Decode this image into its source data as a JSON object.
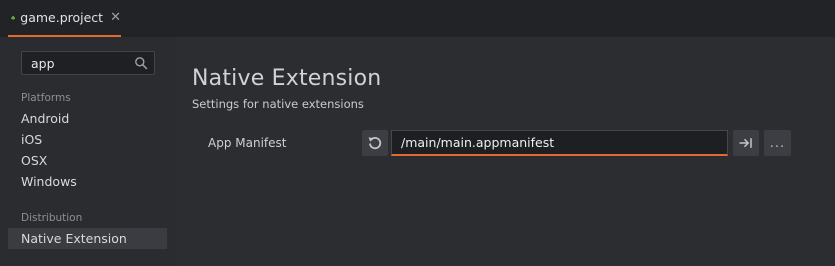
{
  "tabs": [
    {
      "label": "game.project",
      "close_glyph": "✕",
      "icon": "defold-leaf-icon",
      "accent": "#e26a31",
      "icon_color": "#6ac044"
    }
  ],
  "sidebar": {
    "search": {
      "value": "app",
      "placeholder": ""
    },
    "sections": [
      {
        "label": "Platforms",
        "items": [
          "Android",
          "iOS",
          "OSX",
          "Windows"
        ]
      },
      {
        "label": "Distribution",
        "items": [
          "Native Extension"
        ]
      }
    ],
    "selected": "Native Extension"
  },
  "main": {
    "title": "Native Extension",
    "subtitle": "Settings for native extensions",
    "fields": [
      {
        "label": "App Manifest",
        "value": "/main/main.appmanifest",
        "browse_label": "..."
      }
    ]
  },
  "colors": {
    "background": "#2c2d31",
    "tabbar": "#222326",
    "accent": "#e26a31",
    "selected_item": "#3a3c41"
  }
}
